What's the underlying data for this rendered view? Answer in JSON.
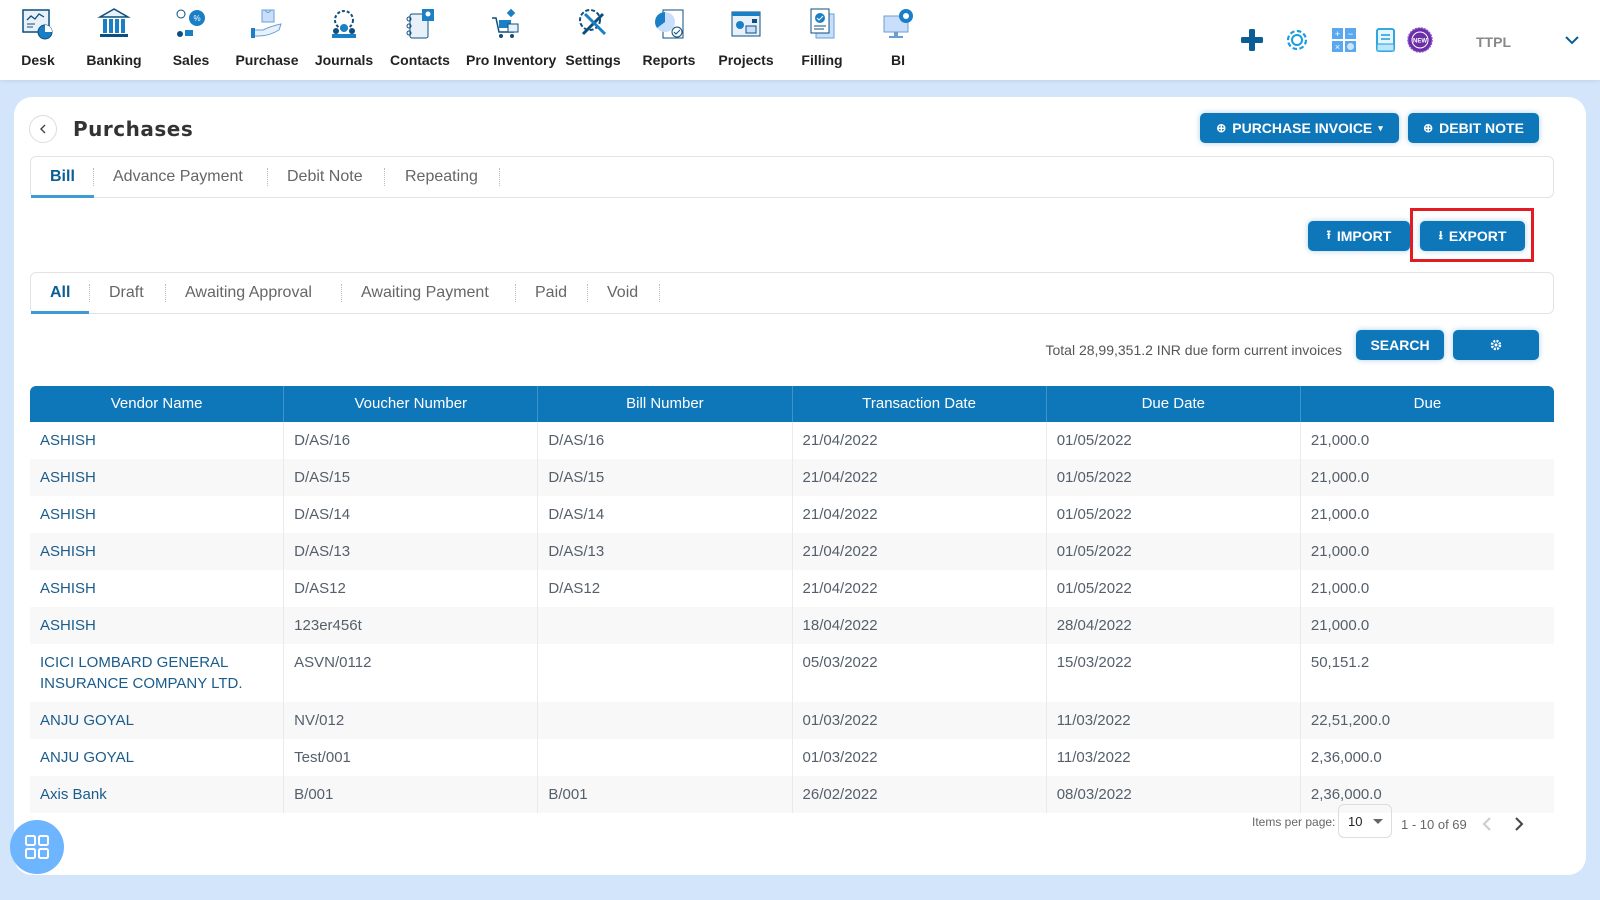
{
  "nav": {
    "items": [
      {
        "id": "desk",
        "label": "Desk",
        "icon": "desk-icon"
      },
      {
        "id": "banking",
        "label": "Banking",
        "icon": "bank-icon"
      },
      {
        "id": "sales",
        "label": "Sales",
        "icon": "sales-icon"
      },
      {
        "id": "purchase",
        "label": "Purchase",
        "icon": "purchase-icon"
      },
      {
        "id": "journals",
        "label": "Journals",
        "icon": "journals-icon"
      },
      {
        "id": "contacts",
        "label": "Contacts",
        "icon": "contacts-icon"
      },
      {
        "id": "pro-inventory",
        "label": "Pro Inventory",
        "icon": "inventory-icon"
      },
      {
        "id": "settings",
        "label": "Settings",
        "icon": "settings-tools-icon"
      },
      {
        "id": "reports",
        "label": "Reports",
        "icon": "reports-icon"
      },
      {
        "id": "projects",
        "label": "Projects",
        "icon": "projects-icon"
      },
      {
        "id": "filling",
        "label": "Filling",
        "icon": "filling-icon"
      },
      {
        "id": "bi",
        "label": "BI",
        "icon": "bi-icon"
      }
    ],
    "right": {
      "org_name": "TTPL",
      "new_badge": "NEW",
      "icons": [
        "plus-icon",
        "gear-icon",
        "calculator-icon",
        "notes-icon",
        "new-badge-icon",
        "chevron-down-icon"
      ]
    }
  },
  "header": {
    "title": "Purchases",
    "purchase_invoice_label": "PURCHASE INVOICE",
    "debit_note_label": "DEBIT NOTE"
  },
  "tabs": [
    {
      "label": "Bill",
      "active": true
    },
    {
      "label": "Advance Payment",
      "active": false
    },
    {
      "label": "Debit Note",
      "active": false
    },
    {
      "label": "Repeating",
      "active": false
    }
  ],
  "actions": {
    "import_label": "IMPORT",
    "export_label": "EXPORT"
  },
  "status_tabs": [
    {
      "label": "All",
      "active": true
    },
    {
      "label": "Draft",
      "active": false
    },
    {
      "label": "Awaiting Approval",
      "active": false
    },
    {
      "label": "Awaiting Payment",
      "active": false
    },
    {
      "label": "Paid",
      "active": false
    },
    {
      "label": "Void",
      "active": false
    }
  ],
  "summary": {
    "total_text": "Total 28,99,351.2 INR due form current invoices",
    "search_label": "SEARCH"
  },
  "table": {
    "columns": [
      "Vendor Name",
      "Voucher Number",
      "Bill Number",
      "Transaction Date",
      "Due Date",
      "Due"
    ],
    "rows": [
      [
        "ASHISH",
        "D/AS/16",
        "D/AS/16",
        "21/04/2022",
        "01/05/2022",
        "21,000.0"
      ],
      [
        "ASHISH",
        "D/AS/15",
        "D/AS/15",
        "21/04/2022",
        "01/05/2022",
        "21,000.0"
      ],
      [
        "ASHISH",
        "D/AS/14",
        "D/AS/14",
        "21/04/2022",
        "01/05/2022",
        "21,000.0"
      ],
      [
        "ASHISH",
        "D/AS/13",
        "D/AS/13",
        "21/04/2022",
        "01/05/2022",
        "21,000.0"
      ],
      [
        "ASHISH",
        "D/AS12",
        "D/AS12",
        "21/04/2022",
        "01/05/2022",
        "21,000.0"
      ],
      [
        "ASHISH",
        "123er456t",
        "",
        "18/04/2022",
        "28/04/2022",
        "21,000.0"
      ],
      [
        "ICICI LOMBARD GENERAL INSURANCE COMPANY LTD.",
        "ASVN/0112",
        "",
        "05/03/2022",
        "15/03/2022",
        "50,151.2"
      ],
      [
        "ANJU GOYAL",
        "NV/012",
        "",
        "01/03/2022",
        "11/03/2022",
        "22,51,200.0"
      ],
      [
        "ANJU GOYAL",
        "Test/001",
        "",
        "01/03/2022",
        "11/03/2022",
        "2,36,000.0"
      ],
      [
        "Axis Bank",
        "B/001",
        "B/001",
        "26/02/2022",
        "08/03/2022",
        "2,36,000.0"
      ]
    ]
  },
  "pagination": {
    "items_per_page_label": "Items per page:",
    "items_per_page": "10",
    "range": "1 - 10 of 69"
  },
  "colors": {
    "primary": "#0e77ba",
    "page_bg": "#d3e5fb",
    "highlight": "#e31b23",
    "fab": "#6db5ff"
  }
}
